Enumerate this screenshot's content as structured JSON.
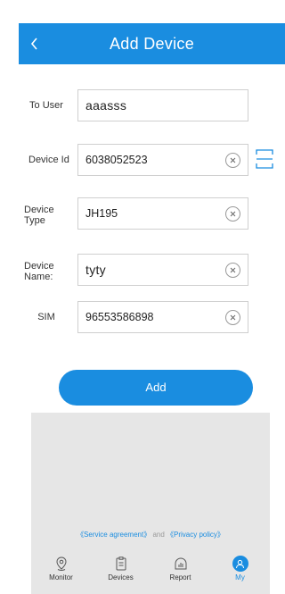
{
  "header": {
    "title": "Add Device",
    "back_icon": "chevron-left-icon"
  },
  "form": {
    "to_user": {
      "label": "To User",
      "value": "aaasss"
    },
    "device_id": {
      "label": "Device Id",
      "value": "6038052523"
    },
    "device_type": {
      "label_line1": "Device",
      "label_line2": "Type",
      "value": "JH195"
    },
    "device_name": {
      "label_line1": "Device",
      "label_line2": "Name:",
      "value": "tyty"
    },
    "sim": {
      "label": "SIM",
      "value": "96553586898"
    }
  },
  "add_button": {
    "label": "Add"
  },
  "agreement": {
    "service": "《Service agreement》",
    "and": " and ",
    "privacy": "《Privacy policy》"
  },
  "tabbar": {
    "tabs": [
      {
        "label": "Monitor",
        "icon": "location-pin-icon"
      },
      {
        "label": "Devices",
        "icon": "document-icon"
      },
      {
        "label": "Report",
        "icon": "report-chart-icon"
      },
      {
        "label": "My",
        "icon": "user-icon",
        "active": true
      }
    ]
  },
  "colors": {
    "primary": "#1a8de0",
    "gray_area": "#e6e6e6",
    "link": "#1a8de0"
  }
}
